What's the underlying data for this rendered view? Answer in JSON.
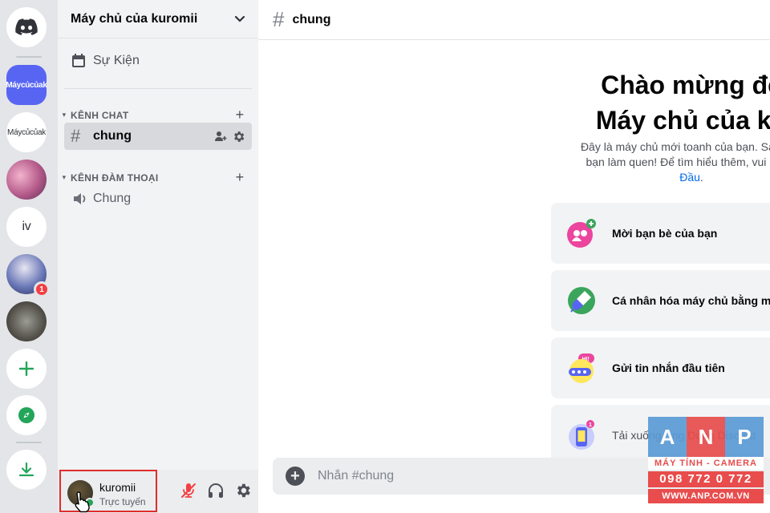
{
  "colors": {
    "brand": "#5865f2",
    "online": "#23a55a",
    "danger": "#f23f43",
    "link": "#006ce7"
  },
  "rail": {
    "servers": [
      {
        "label": "",
        "icon": "discord-logo-icon"
      },
      {
        "label": "Máycủcủak",
        "active": true
      },
      {
        "label": "Máycủcủak"
      },
      {
        "label": "",
        "icon": "anime-avatar-pink"
      },
      {
        "label": "iv"
      },
      {
        "label": "",
        "icon": "anime-avatar-blue",
        "badge": "1"
      },
      {
        "label": "",
        "icon": "cat-avatar"
      },
      {
        "label": "",
        "icon": "plus-icon"
      },
      {
        "label": "",
        "icon": "compass-icon"
      },
      {
        "label": "",
        "icon": "download-icon"
      }
    ]
  },
  "sidebar": {
    "guild_name": "Máy chủ của kuromii",
    "events_label": "Sự Kiện",
    "categories": [
      {
        "label": "KÊNH CHAT",
        "channels": [
          {
            "name": "chung",
            "type": "text",
            "selected": true
          }
        ]
      },
      {
        "label": "KÊNH ĐÀM THOẠI",
        "channels": [
          {
            "name": "Chung",
            "type": "voice"
          }
        ]
      }
    ]
  },
  "user": {
    "name": "kuromii",
    "status": "Trực tuyến"
  },
  "main": {
    "channel_name": "chung",
    "welcome_line1": "Chào mừng đế",
    "welcome_line2": "Máy chủ của ku",
    "desc_line1": "Đây là máy chủ mới toanh của bạn. Sau đây",
    "desc_line2": "bạn làm quen! Để tìm hiểu thêm, vui lòng t",
    "desc_link": "Đầu",
    "desc_end": ".",
    "cards": [
      {
        "label": "Mời bạn bè của bạn",
        "icon": "invite-friends-icon"
      },
      {
        "label": "Cá nhân hóa máy chủ bằng một",
        "icon": "paintbrush-icon"
      },
      {
        "label": "Gửi tin nhắn đầu tiên",
        "icon": "chat-bubble-icon"
      },
      {
        "label": "Tải xuống ứng Dụng Discord",
        "icon": "phone-icon"
      }
    ],
    "composer_placeholder": "Nhắn #chung"
  },
  "watermark": {
    "letters": [
      "A",
      "N",
      "P"
    ],
    "subtitle": "MÁY TÍNH - CAMERA",
    "phone": "098 772 0 772",
    "website": "WWW.ANP.COM.VN"
  }
}
